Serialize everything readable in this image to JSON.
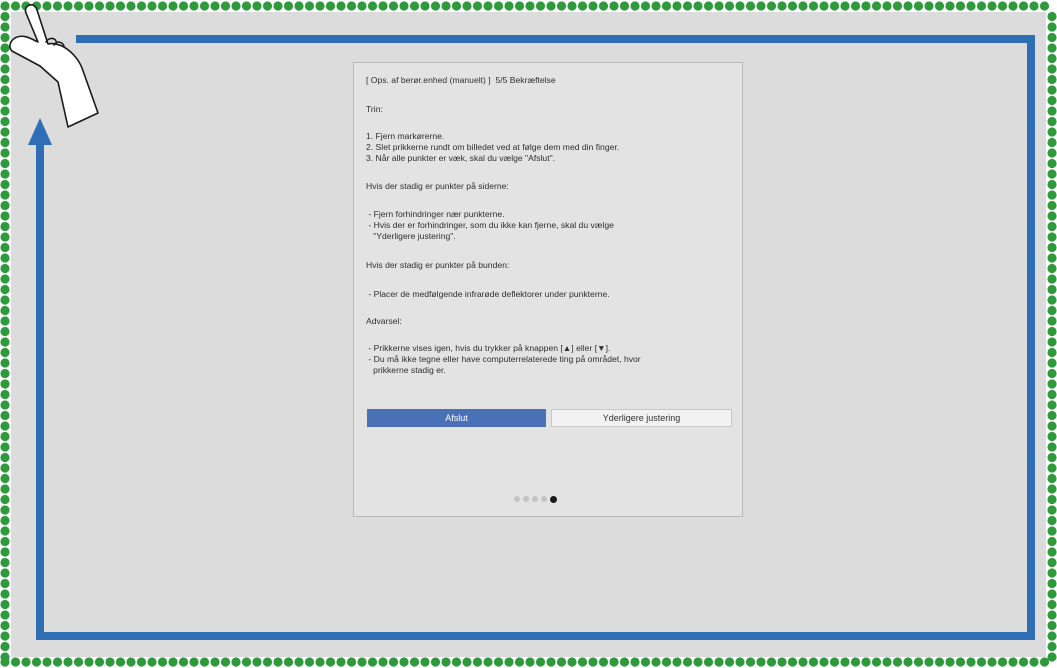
{
  "dialog": {
    "title": "[ Ops. af berør.enhed (manuelt) ]  5/5 Bekræftelse",
    "steps_heading": "Trin:",
    "steps": [
      "1. Fjern markørerne.",
      "2. Slet prikkerne rundt om billedet ved at følge dem med din finger.",
      "3. Når alle punkter er væk, skal du vælge \"Afslut\"."
    ],
    "sides_heading": "Hvis der stadig er punkter på siderne:",
    "sides_items": [
      " - Fjern forhindringer nær punkterne.",
      " - Hvis der er forhindringer, som du ikke kan fjerne, skal du vælge",
      "   \"Yderligere justering\"."
    ],
    "bottom_heading": "Hvis der stadig er punkter på bunden:",
    "bottom_items": [
      " - Placer de medfølgende infrarøde deflektorer under punkterne."
    ],
    "warning_heading": "Advarsel:",
    "warning_items": [
      " - Prikkerne vises igen, hvis du trykker på knappen [▲] eller [▼].",
      " - Du må ikke tegne eller have computerrelaterede ting på området, hvor",
      "   prikkerne stadig er."
    ],
    "finish_button": "Afslut",
    "adjust_button": "Yderligere justering",
    "page_indicator": {
      "total": 5,
      "current": 5
    }
  },
  "colors": {
    "dot_border": "#2e9a3c",
    "arrow": "#2f6db5",
    "screen_bg": "#dcdcdc",
    "primary_button": "#4a70b8"
  },
  "icons": [
    "hand-pointer-icon",
    "up-arrow-icon"
  ]
}
